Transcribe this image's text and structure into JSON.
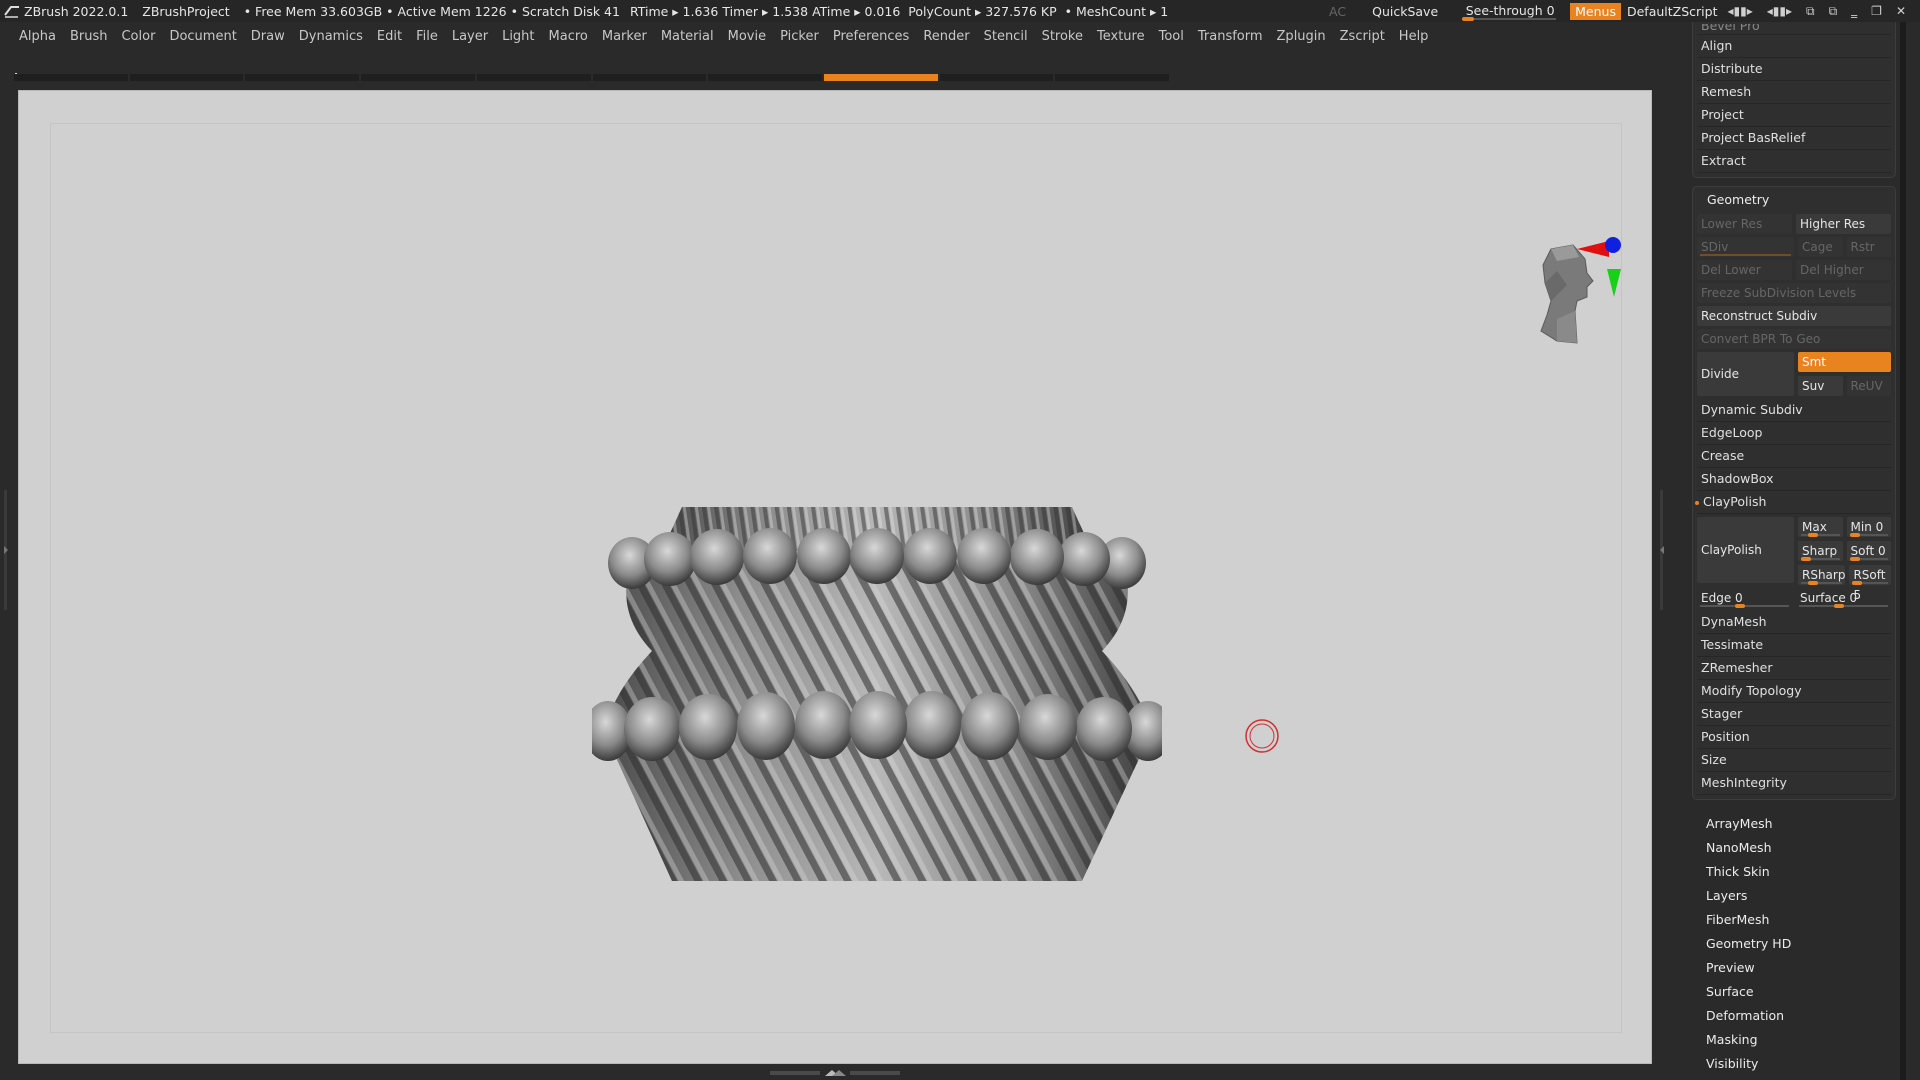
{
  "titlebar": {
    "app": "ZBrush 2022.0.1",
    "project": "ZBrushProject",
    "free_mem": "• Free Mem 33.603GB",
    "active_mem": "• Active Mem 1226",
    "scratch": "• Scratch Disk 41",
    "rtime": "RTime ▸ 1.636",
    "timer": "Timer ▸ 1.538",
    "atime": "ATime ▸ 0.016",
    "polycount": "PolyCount ▸ 327.576 KP",
    "meshcount": "• MeshCount ▸ 1",
    "ac": "AC",
    "quicksave": "QuickSave",
    "seethrough": "See-through  0",
    "seethrough_value": 0,
    "menus": "Menus",
    "script": "DefaultZScript"
  },
  "menubar": [
    "Alpha",
    "Brush",
    "Color",
    "Document",
    "Draw",
    "Dynamics",
    "Edit",
    "File",
    "Layer",
    "Light",
    "Macro",
    "Marker",
    "Material",
    "Movie",
    "Picker",
    "Preferences",
    "Render",
    "Stencil",
    "Stroke",
    "Texture",
    "Tool",
    "Transform",
    "Zplugin",
    "Zscript",
    "Help"
  ],
  "tabstrip": {
    "count": 10,
    "active_index": 7
  },
  "panel": {
    "top_cut": "Bevel Pro",
    "top_items": [
      "Align",
      "Distribute",
      "Remesh",
      "Project",
      "Project BasRelief",
      "Extract"
    ],
    "geometry": {
      "title": "Geometry",
      "lower_res": "Lower Res",
      "higher_res": "Higher Res",
      "sdiv": "SDiv",
      "cage": "Cage",
      "rstr": "Rstr",
      "del_lower": "Del Lower",
      "del_higher": "Del Higher",
      "freeze": "Freeze SubDivision Levels",
      "reconstruct": "Reconstruct Subdiv",
      "convert": "Convert BPR To Geo",
      "divide": "Divide",
      "smt": "Smt",
      "suv": "Suv",
      "reuv": "ReUV",
      "items_a": [
        "Dynamic Subdiv",
        "EdgeLoop",
        "Crease",
        "ShadowBox"
      ],
      "claypolish_head": "ClayPolish",
      "claypolish_btn": "ClayPolish",
      "max": "Max 25",
      "min": "Min 0",
      "sharp": "Sharp",
      "soft": "Soft 0",
      "rsharp": "RSharp",
      "rsoft": "RSoft 5",
      "edge": "Edge 0",
      "surface": "Surface 0",
      "items_b": [
        "DynaMesh",
        "Tessimate",
        "ZRemesher",
        "Modify Topology",
        "Stager",
        "Position",
        "Size",
        "MeshIntegrity"
      ]
    },
    "sub_items": [
      "ArrayMesh",
      "NanoMesh",
      "Thick Skin",
      "Layers",
      "FiberMesh",
      "Geometry HD",
      "Preview",
      "Surface",
      "Deformation",
      "Masking",
      "Visibility"
    ]
  },
  "colors": {
    "accent": "#e9831f",
    "canvas": "#d0d0d0",
    "panel": "#2f2f2f"
  }
}
